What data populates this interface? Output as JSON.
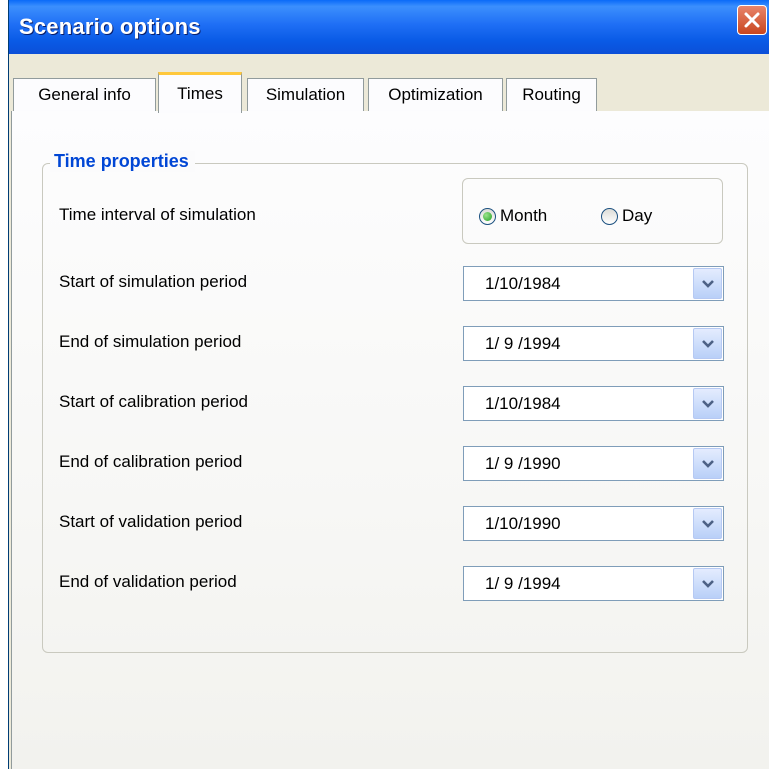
{
  "window": {
    "title": "Scenario options"
  },
  "tabs": [
    {
      "label": "General info"
    },
    {
      "label": "Times"
    },
    {
      "label": "Simulation"
    },
    {
      "label": "Optimization"
    },
    {
      "label": "Routing"
    }
  ],
  "active_tab": "Times",
  "time_properties": {
    "title": "Time properties",
    "interval_label": "Time interval of simulation",
    "interval_options": [
      {
        "label": "Month",
        "selected": true
      },
      {
        "label": "Day",
        "selected": false
      }
    ],
    "rows": [
      {
        "label": "Start of simulation period",
        "value": "1/10/1984"
      },
      {
        "label": "End of simulation period",
        "value": "1/ 9 /1994"
      },
      {
        "label": "Start of calibration period",
        "value": "1/10/1984"
      },
      {
        "label": "End of calibration period",
        "value": "1/ 9 /1990"
      },
      {
        "label": "Start of validation period",
        "value": "1/10/1990"
      },
      {
        "label": "End of validation period",
        "value": "1/ 9 /1994"
      }
    ]
  },
  "colors": {
    "titlebar": "#0A5BE6",
    "group_title": "#0046D5",
    "active_tab_accent": "#FFC83C",
    "radio_selected": "#21A121",
    "close_button": "#C9461F"
  },
  "icons": {
    "close": "close-icon",
    "combo_arrow": "chevron-down-icon"
  }
}
